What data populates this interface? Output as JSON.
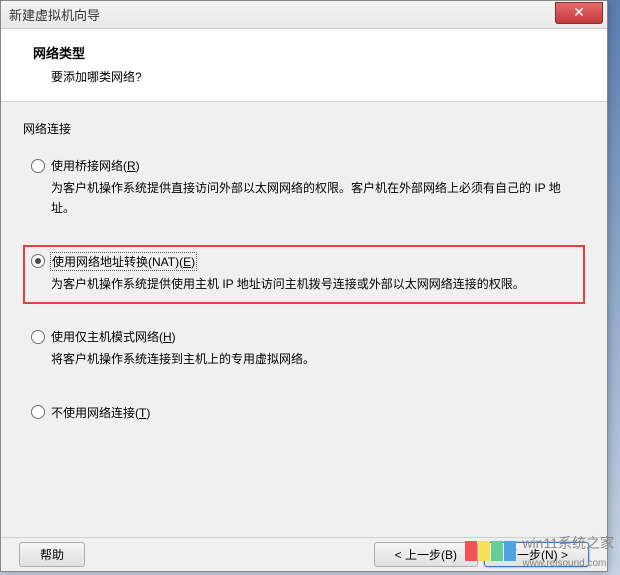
{
  "window": {
    "title": "新建虚拟机向导",
    "close_symbol": "✕"
  },
  "header": {
    "title": "网络类型",
    "subtitle": "要添加哪类网络?"
  },
  "section_label": "网络连接",
  "options": {
    "bridged": {
      "label_prefix": "使用桥接网络(",
      "key": "R",
      "label_suffix": ")",
      "desc": "为客户机操作系统提供直接访问外部以太网网络的权限。客户机在外部网络上必须有自己的 IP 地址。"
    },
    "nat": {
      "label_prefix": "使用网络地址转换(NAT)(",
      "key": "E",
      "label_suffix": ")",
      "desc": "为客户机操作系统提供使用主机 IP 地址访问主机拨号连接或外部以太网网络连接的权限。"
    },
    "hostonly": {
      "label_prefix": "使用仅主机模式网络(",
      "key": "H",
      "label_suffix": ")",
      "desc": "将客户机操作系统连接到主机上的专用虚拟网络。"
    },
    "none": {
      "label_prefix": "不使用网络连接(",
      "key": "T",
      "label_suffix": ")"
    }
  },
  "buttons": {
    "help": "帮助",
    "back": "< 上一步(B)",
    "next": "下一步(N) >"
  },
  "watermark": {
    "text": "win11系统之家",
    "url": "www.relsound.com"
  }
}
